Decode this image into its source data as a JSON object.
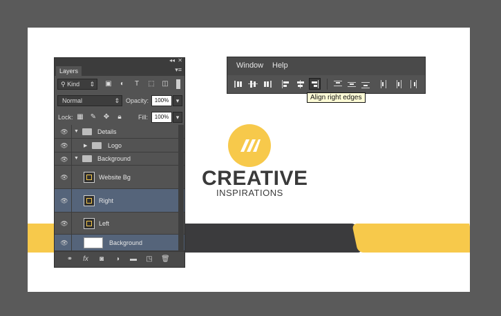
{
  "canvas": {
    "logo": {
      "mark": "//",
      "title": "CREATIVE",
      "subtitle": "INSPIRATIONS"
    }
  },
  "layers_panel": {
    "tab_label": "Layers",
    "kind_label": "Kind",
    "blend_mode": "Normal",
    "opacity_label": "Opacity:",
    "opacity_value": "100%",
    "lock_label": "Lock:",
    "fill_label": "Fill:",
    "fill_value": "100%",
    "layers": [
      {
        "name": "Details",
        "type": "group",
        "expanded": true
      },
      {
        "name": "Logo",
        "type": "group",
        "expanded": false
      },
      {
        "name": "Background",
        "type": "group",
        "expanded": true
      },
      {
        "name": "Website Bg",
        "type": "smart-object"
      },
      {
        "name": "Right",
        "type": "smart-object",
        "selected": true
      },
      {
        "name": "Left",
        "type": "smart-object"
      },
      {
        "name": "Background",
        "type": "layer",
        "selected": true
      }
    ],
    "bottom_icons": [
      "link-icon",
      "fx-icon",
      "mask-icon",
      "adjustment-icon",
      "folder-icon",
      "new-layer-icon",
      "trash-icon"
    ]
  },
  "menubar": {
    "menus": [
      "Window",
      "Help"
    ],
    "tooltip": "Align right edges"
  },
  "colors": {
    "accent_yellow": "#f7c94b",
    "dark_band": "#3b3b3d",
    "panel_bg": "#535353",
    "selection": "#55647a"
  }
}
